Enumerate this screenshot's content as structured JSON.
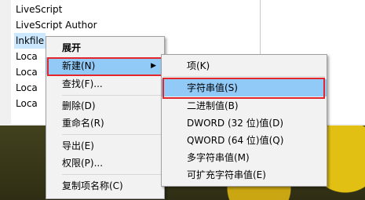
{
  "tree": {
    "items": [
      "LiveScript",
      "LiveScript Author",
      "lnkfile",
      "Loca",
      "Loca",
      "Loca",
      "Loca"
    ]
  },
  "context_menu": {
    "items": [
      {
        "label": "展开",
        "bold": true
      },
      {
        "label": "新建(N)",
        "has_submenu": true,
        "highlighted": true
      },
      {
        "label": "查找(F)..."
      },
      {
        "label": "删除(D)"
      },
      {
        "label": "重命名(R)"
      },
      {
        "label": "导出(E)"
      },
      {
        "label": "权限(P)..."
      },
      {
        "label": "复制项名称(C)"
      }
    ]
  },
  "submenu": {
    "items": [
      {
        "label": "项(K)"
      },
      {
        "label": "字符串值(S)",
        "highlighted": true
      },
      {
        "label": "二进制值(B)"
      },
      {
        "label": "DWORD (32 位)值(D)"
      },
      {
        "label": "QWORD (64 位)值(Q)"
      },
      {
        "label": "多字符串值(M)"
      },
      {
        "label": "可扩充字符串值(E)"
      }
    ]
  },
  "colors": {
    "highlight": "#91c9f7",
    "annotation_box": "#e3262b",
    "selection": "#cce8ff"
  },
  "icons": {
    "submenu_arrow": "chevron-right-icon"
  }
}
